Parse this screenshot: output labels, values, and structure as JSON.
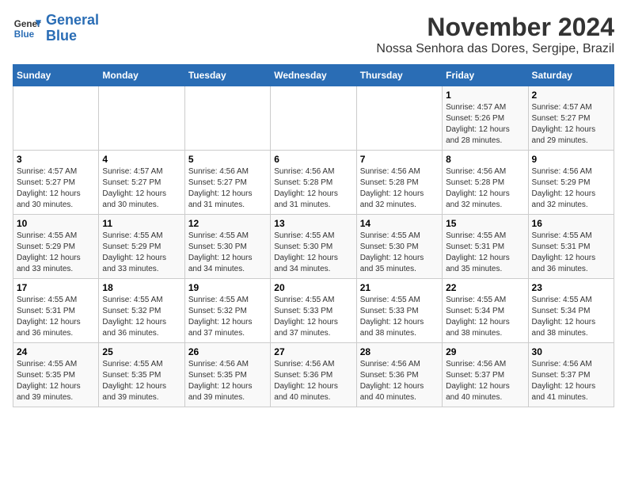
{
  "header": {
    "logo_line1": "General",
    "logo_line2": "Blue",
    "month": "November 2024",
    "location": "Nossa Senhora das Dores, Sergipe, Brazil"
  },
  "days_of_week": [
    "Sunday",
    "Monday",
    "Tuesday",
    "Wednesday",
    "Thursday",
    "Friday",
    "Saturday"
  ],
  "weeks": [
    [
      {
        "day": "",
        "info": ""
      },
      {
        "day": "",
        "info": ""
      },
      {
        "day": "",
        "info": ""
      },
      {
        "day": "",
        "info": ""
      },
      {
        "day": "",
        "info": ""
      },
      {
        "day": "1",
        "info": "Sunrise: 4:57 AM\nSunset: 5:26 PM\nDaylight: 12 hours and 28 minutes."
      },
      {
        "day": "2",
        "info": "Sunrise: 4:57 AM\nSunset: 5:27 PM\nDaylight: 12 hours and 29 minutes."
      }
    ],
    [
      {
        "day": "3",
        "info": "Sunrise: 4:57 AM\nSunset: 5:27 PM\nDaylight: 12 hours and 30 minutes."
      },
      {
        "day": "4",
        "info": "Sunrise: 4:57 AM\nSunset: 5:27 PM\nDaylight: 12 hours and 30 minutes."
      },
      {
        "day": "5",
        "info": "Sunrise: 4:56 AM\nSunset: 5:27 PM\nDaylight: 12 hours and 31 minutes."
      },
      {
        "day": "6",
        "info": "Sunrise: 4:56 AM\nSunset: 5:28 PM\nDaylight: 12 hours and 31 minutes."
      },
      {
        "day": "7",
        "info": "Sunrise: 4:56 AM\nSunset: 5:28 PM\nDaylight: 12 hours and 32 minutes."
      },
      {
        "day": "8",
        "info": "Sunrise: 4:56 AM\nSunset: 5:28 PM\nDaylight: 12 hours and 32 minutes."
      },
      {
        "day": "9",
        "info": "Sunrise: 4:56 AM\nSunset: 5:29 PM\nDaylight: 12 hours and 32 minutes."
      }
    ],
    [
      {
        "day": "10",
        "info": "Sunrise: 4:55 AM\nSunset: 5:29 PM\nDaylight: 12 hours and 33 minutes."
      },
      {
        "day": "11",
        "info": "Sunrise: 4:55 AM\nSunset: 5:29 PM\nDaylight: 12 hours and 33 minutes."
      },
      {
        "day": "12",
        "info": "Sunrise: 4:55 AM\nSunset: 5:30 PM\nDaylight: 12 hours and 34 minutes."
      },
      {
        "day": "13",
        "info": "Sunrise: 4:55 AM\nSunset: 5:30 PM\nDaylight: 12 hours and 34 minutes."
      },
      {
        "day": "14",
        "info": "Sunrise: 4:55 AM\nSunset: 5:30 PM\nDaylight: 12 hours and 35 minutes."
      },
      {
        "day": "15",
        "info": "Sunrise: 4:55 AM\nSunset: 5:31 PM\nDaylight: 12 hours and 35 minutes."
      },
      {
        "day": "16",
        "info": "Sunrise: 4:55 AM\nSunset: 5:31 PM\nDaylight: 12 hours and 36 minutes."
      }
    ],
    [
      {
        "day": "17",
        "info": "Sunrise: 4:55 AM\nSunset: 5:31 PM\nDaylight: 12 hours and 36 minutes."
      },
      {
        "day": "18",
        "info": "Sunrise: 4:55 AM\nSunset: 5:32 PM\nDaylight: 12 hours and 36 minutes."
      },
      {
        "day": "19",
        "info": "Sunrise: 4:55 AM\nSunset: 5:32 PM\nDaylight: 12 hours and 37 minutes."
      },
      {
        "day": "20",
        "info": "Sunrise: 4:55 AM\nSunset: 5:33 PM\nDaylight: 12 hours and 37 minutes."
      },
      {
        "day": "21",
        "info": "Sunrise: 4:55 AM\nSunset: 5:33 PM\nDaylight: 12 hours and 38 minutes."
      },
      {
        "day": "22",
        "info": "Sunrise: 4:55 AM\nSunset: 5:34 PM\nDaylight: 12 hours and 38 minutes."
      },
      {
        "day": "23",
        "info": "Sunrise: 4:55 AM\nSunset: 5:34 PM\nDaylight: 12 hours and 38 minutes."
      }
    ],
    [
      {
        "day": "24",
        "info": "Sunrise: 4:55 AM\nSunset: 5:35 PM\nDaylight: 12 hours and 39 minutes."
      },
      {
        "day": "25",
        "info": "Sunrise: 4:55 AM\nSunset: 5:35 PM\nDaylight: 12 hours and 39 minutes."
      },
      {
        "day": "26",
        "info": "Sunrise: 4:56 AM\nSunset: 5:35 PM\nDaylight: 12 hours and 39 minutes."
      },
      {
        "day": "27",
        "info": "Sunrise: 4:56 AM\nSunset: 5:36 PM\nDaylight: 12 hours and 40 minutes."
      },
      {
        "day": "28",
        "info": "Sunrise: 4:56 AM\nSunset: 5:36 PM\nDaylight: 12 hours and 40 minutes."
      },
      {
        "day": "29",
        "info": "Sunrise: 4:56 AM\nSunset: 5:37 PM\nDaylight: 12 hours and 40 minutes."
      },
      {
        "day": "30",
        "info": "Sunrise: 4:56 AM\nSunset: 5:37 PM\nDaylight: 12 hours and 41 minutes."
      }
    ]
  ]
}
